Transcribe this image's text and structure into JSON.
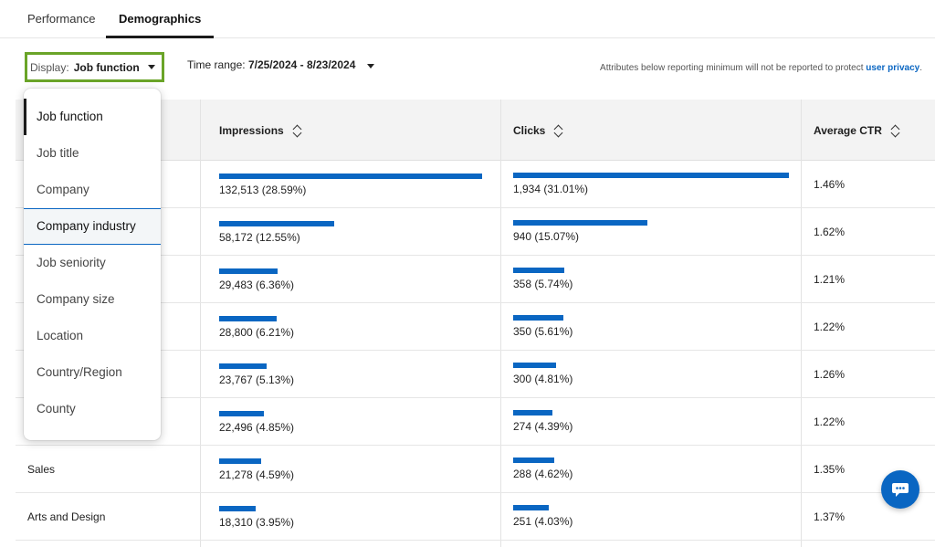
{
  "tabs": [
    {
      "label": "Performance"
    },
    {
      "label": "Demographics"
    }
  ],
  "display": {
    "label": "Display:",
    "value": "Job function"
  },
  "time_range": {
    "label": "Time range:",
    "value": "7/25/2024 - 8/23/2024"
  },
  "notice": {
    "text": "Attributes below reporting minimum will not be reported to protect",
    "link": "user privacy",
    "end": "."
  },
  "columns": {
    "impressions": "Impressions",
    "clicks": "Clicks",
    "ctr": "Average CTR"
  },
  "rows": [
    {
      "name": "",
      "impressions": "132,513 (28.59%)",
      "imp_share": 28.59,
      "clicks": "1,934 (31.01%)",
      "click_share": 31.01,
      "ctr": "1.46%"
    },
    {
      "name": "",
      "impressions": "58,172 (12.55%)",
      "imp_share": 12.55,
      "clicks": "940 (15.07%)",
      "click_share": 15.07,
      "ctr": "1.62%"
    },
    {
      "name": "",
      "impressions": "29,483 (6.36%)",
      "imp_share": 6.36,
      "clicks": "358 (5.74%)",
      "click_share": 5.74,
      "ctr": "1.21%"
    },
    {
      "name": "",
      "impressions": "28,800 (6.21%)",
      "imp_share": 6.21,
      "clicks": "350 (5.61%)",
      "click_share": 5.61,
      "ctr": "1.22%"
    },
    {
      "name": "",
      "impressions": "23,767 (5.13%)",
      "imp_share": 5.13,
      "clicks": "300 (4.81%)",
      "click_share": 4.81,
      "ctr": "1.26%"
    },
    {
      "name": "",
      "impressions": "22,496 (4.85%)",
      "imp_share": 4.85,
      "clicks": "274 (4.39%)",
      "click_share": 4.39,
      "ctr": "1.22%"
    },
    {
      "name": "Sales",
      "impressions": "21,278 (4.59%)",
      "imp_share": 4.59,
      "clicks": "288 (4.62%)",
      "click_share": 4.62,
      "ctr": "1.35%"
    },
    {
      "name": "Arts and Design",
      "impressions": "18,310 (3.95%)",
      "imp_share": 3.95,
      "clicks": "251 (4.03%)",
      "click_share": 4.03,
      "ctr": "1.37%"
    }
  ],
  "menu": {
    "items": [
      {
        "label": "Job function"
      },
      {
        "label": "Job title"
      },
      {
        "label": "Company"
      },
      {
        "label": "Company industry"
      },
      {
        "label": "Job seniority"
      },
      {
        "label": "Company size"
      },
      {
        "label": "Location"
      },
      {
        "label": "Country/Region"
      },
      {
        "label": "County"
      }
    ],
    "selected": "Job function",
    "focused": "Company industry"
  },
  "colors": {
    "accent": "#0a66c2",
    "highlight_border": "#6aa428"
  },
  "icons": {
    "sort": "sort-icon",
    "caret": "caret-down-icon",
    "chat": "chat-icon"
  }
}
